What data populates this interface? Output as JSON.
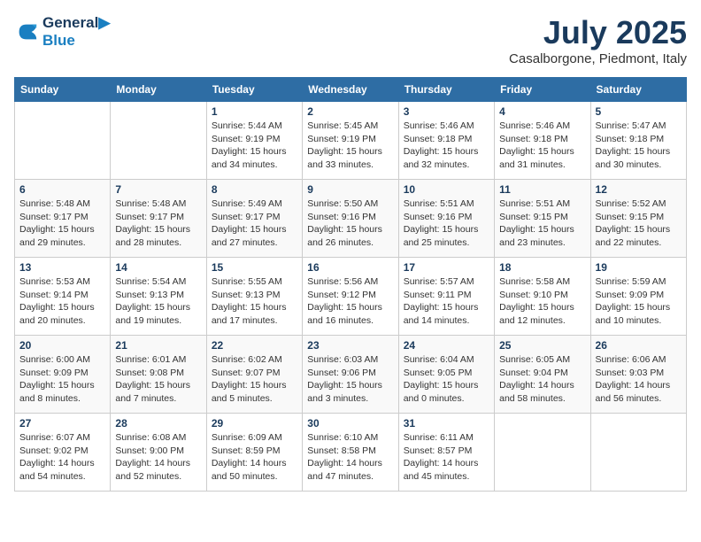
{
  "header": {
    "logo_line1": "General",
    "logo_line2": "Blue",
    "month": "July 2025",
    "location": "Casalborgone, Piedmont, Italy"
  },
  "columns": [
    "Sunday",
    "Monday",
    "Tuesday",
    "Wednesday",
    "Thursday",
    "Friday",
    "Saturday"
  ],
  "weeks": [
    [
      {
        "day": "",
        "info": ""
      },
      {
        "day": "",
        "info": ""
      },
      {
        "day": "1",
        "info": "Sunrise: 5:44 AM\nSunset: 9:19 PM\nDaylight: 15 hours\nand 34 minutes."
      },
      {
        "day": "2",
        "info": "Sunrise: 5:45 AM\nSunset: 9:19 PM\nDaylight: 15 hours\nand 33 minutes."
      },
      {
        "day": "3",
        "info": "Sunrise: 5:46 AM\nSunset: 9:18 PM\nDaylight: 15 hours\nand 32 minutes."
      },
      {
        "day": "4",
        "info": "Sunrise: 5:46 AM\nSunset: 9:18 PM\nDaylight: 15 hours\nand 31 minutes."
      },
      {
        "day": "5",
        "info": "Sunrise: 5:47 AM\nSunset: 9:18 PM\nDaylight: 15 hours\nand 30 minutes."
      }
    ],
    [
      {
        "day": "6",
        "info": "Sunrise: 5:48 AM\nSunset: 9:17 PM\nDaylight: 15 hours\nand 29 minutes."
      },
      {
        "day": "7",
        "info": "Sunrise: 5:48 AM\nSunset: 9:17 PM\nDaylight: 15 hours\nand 28 minutes."
      },
      {
        "day": "8",
        "info": "Sunrise: 5:49 AM\nSunset: 9:17 PM\nDaylight: 15 hours\nand 27 minutes."
      },
      {
        "day": "9",
        "info": "Sunrise: 5:50 AM\nSunset: 9:16 PM\nDaylight: 15 hours\nand 26 minutes."
      },
      {
        "day": "10",
        "info": "Sunrise: 5:51 AM\nSunset: 9:16 PM\nDaylight: 15 hours\nand 25 minutes."
      },
      {
        "day": "11",
        "info": "Sunrise: 5:51 AM\nSunset: 9:15 PM\nDaylight: 15 hours\nand 23 minutes."
      },
      {
        "day": "12",
        "info": "Sunrise: 5:52 AM\nSunset: 9:15 PM\nDaylight: 15 hours\nand 22 minutes."
      }
    ],
    [
      {
        "day": "13",
        "info": "Sunrise: 5:53 AM\nSunset: 9:14 PM\nDaylight: 15 hours\nand 20 minutes."
      },
      {
        "day": "14",
        "info": "Sunrise: 5:54 AM\nSunset: 9:13 PM\nDaylight: 15 hours\nand 19 minutes."
      },
      {
        "day": "15",
        "info": "Sunrise: 5:55 AM\nSunset: 9:13 PM\nDaylight: 15 hours\nand 17 minutes."
      },
      {
        "day": "16",
        "info": "Sunrise: 5:56 AM\nSunset: 9:12 PM\nDaylight: 15 hours\nand 16 minutes."
      },
      {
        "day": "17",
        "info": "Sunrise: 5:57 AM\nSunset: 9:11 PM\nDaylight: 15 hours\nand 14 minutes."
      },
      {
        "day": "18",
        "info": "Sunrise: 5:58 AM\nSunset: 9:10 PM\nDaylight: 15 hours\nand 12 minutes."
      },
      {
        "day": "19",
        "info": "Sunrise: 5:59 AM\nSunset: 9:09 PM\nDaylight: 15 hours\nand 10 minutes."
      }
    ],
    [
      {
        "day": "20",
        "info": "Sunrise: 6:00 AM\nSunset: 9:09 PM\nDaylight: 15 hours\nand 8 minutes."
      },
      {
        "day": "21",
        "info": "Sunrise: 6:01 AM\nSunset: 9:08 PM\nDaylight: 15 hours\nand 7 minutes."
      },
      {
        "day": "22",
        "info": "Sunrise: 6:02 AM\nSunset: 9:07 PM\nDaylight: 15 hours\nand 5 minutes."
      },
      {
        "day": "23",
        "info": "Sunrise: 6:03 AM\nSunset: 9:06 PM\nDaylight: 15 hours\nand 3 minutes."
      },
      {
        "day": "24",
        "info": "Sunrise: 6:04 AM\nSunset: 9:05 PM\nDaylight: 15 hours\nand 0 minutes."
      },
      {
        "day": "25",
        "info": "Sunrise: 6:05 AM\nSunset: 9:04 PM\nDaylight: 14 hours\nand 58 minutes."
      },
      {
        "day": "26",
        "info": "Sunrise: 6:06 AM\nSunset: 9:03 PM\nDaylight: 14 hours\nand 56 minutes."
      }
    ],
    [
      {
        "day": "27",
        "info": "Sunrise: 6:07 AM\nSunset: 9:02 PM\nDaylight: 14 hours\nand 54 minutes."
      },
      {
        "day": "28",
        "info": "Sunrise: 6:08 AM\nSunset: 9:00 PM\nDaylight: 14 hours\nand 52 minutes."
      },
      {
        "day": "29",
        "info": "Sunrise: 6:09 AM\nSunset: 8:59 PM\nDaylight: 14 hours\nand 50 minutes."
      },
      {
        "day": "30",
        "info": "Sunrise: 6:10 AM\nSunset: 8:58 PM\nDaylight: 14 hours\nand 47 minutes."
      },
      {
        "day": "31",
        "info": "Sunrise: 6:11 AM\nSunset: 8:57 PM\nDaylight: 14 hours\nand 45 minutes."
      },
      {
        "day": "",
        "info": ""
      },
      {
        "day": "",
        "info": ""
      }
    ]
  ]
}
